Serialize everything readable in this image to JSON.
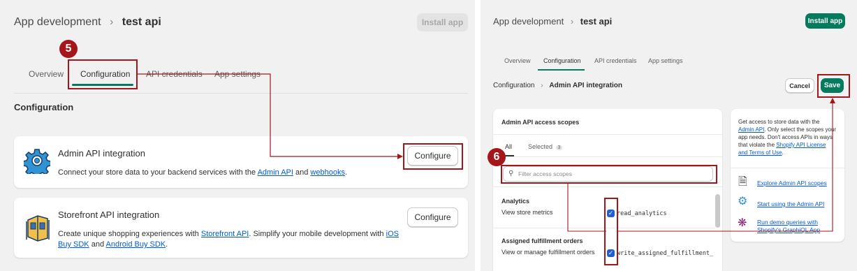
{
  "left": {
    "breadcrumb": {
      "parent": "App development",
      "separator": ">",
      "current": "test api"
    },
    "install_label": "Install app",
    "step_badge": "5",
    "tabs": [
      "Overview",
      "Configuration",
      "API credentials",
      "App settings"
    ],
    "section_heading": "Configuration",
    "admin": {
      "title": "Admin API integration",
      "desc_prefix": "Connect your store data to your backend services with the",
      "link1": "Admin API",
      "and": "and",
      "link2": "webhooks",
      "suffix": ".",
      "button": "Configure"
    },
    "storefront": {
      "title": "Storefront API integration",
      "desc_prefix": "Create unique shopping experiences with",
      "link1": "Storefront API",
      "mid": ". Simplify your mobile development with",
      "link2a": "iOS",
      "link2b": "Buy SDK",
      "and": "and",
      "link3": "Android Buy SDK",
      "suffix": ".",
      "button": "Configure"
    }
  },
  "right": {
    "breadcrumb": {
      "parent": "App development",
      "separator": ">",
      "current": "test api"
    },
    "install_label": "Install app",
    "tabs": [
      "Overview",
      "Configuration",
      "API credentials",
      "App settings"
    ],
    "sub_breadcrumb": {
      "parent": "Configuration",
      "separator": ">",
      "current": "Admin API integration"
    },
    "cancel_label": "Cancel",
    "save_label": "Save",
    "step_badge": "6",
    "scopes": {
      "title": "Admin API access scopes",
      "tab_all": "All",
      "tab_selected": "Selected",
      "selected_count": "3",
      "filter_placeholder": "Filter access scopes",
      "groups": [
        {
          "name": "Analytics",
          "desc": "View store metrics",
          "scope": "read_analytics"
        },
        {
          "name": "Assigned fulfillment orders",
          "desc": "View or manage fulfillment orders",
          "scope": "write_assigned_fulfillment_"
        }
      ]
    },
    "info": {
      "l1": "Get access to store data with the",
      "l2_link": "Admin API",
      "l2_rest": ". Only select the scopes your",
      "l3": "app needs. Don't access APIs in ways",
      "l4_pre": "that violate the",
      "l4_link": "Shopify API License",
      "l5_link": "and Terms of Use",
      "l5_rest": ".",
      "links": [
        "Explore Admin API scopes",
        "Start using the Admin API",
        "Run demo queries with",
        "Shopify's GraphiQL App"
      ]
    }
  },
  "colors": {
    "annotation": "#a4161a",
    "primary": "#047b5d",
    "link": "#005bd3",
    "checkbox": "#1f5fd1"
  }
}
